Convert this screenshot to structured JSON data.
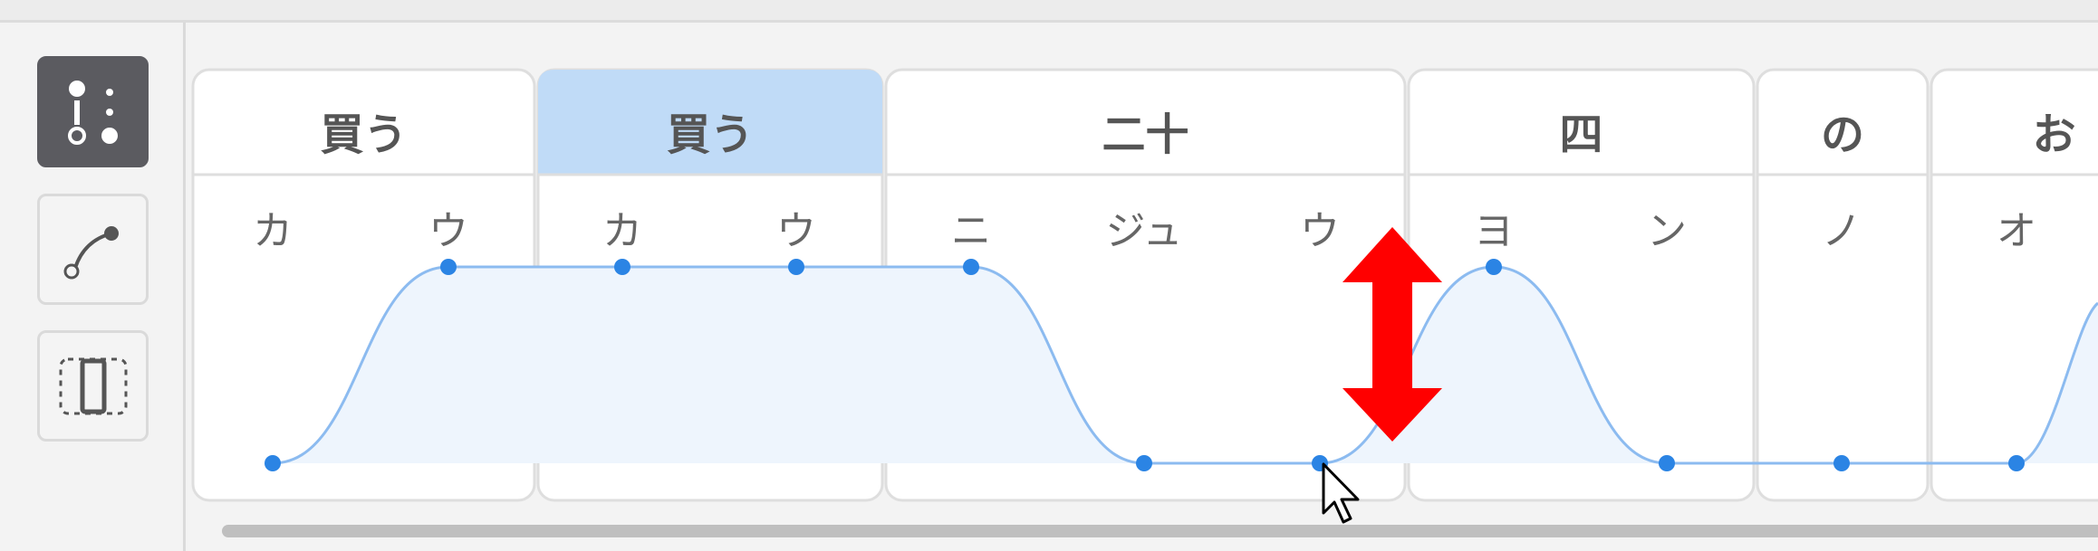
{
  "toolbar": {
    "tools": [
      {
        "name": "pitch-points-tool",
        "active": true
      },
      {
        "name": "curve-draw-tool",
        "active": false
      },
      {
        "name": "range-select-tool",
        "active": false
      }
    ]
  },
  "words": [
    {
      "text": "買う",
      "selected": false
    },
    {
      "text": "買う",
      "selected": true
    },
    {
      "text": "二十",
      "selected": false
    },
    {
      "text": "四",
      "selected": false
    },
    {
      "text": "の",
      "selected": false
    },
    {
      "text": "お",
      "selected": false
    }
  ],
  "moras": [
    "カ",
    "ウ",
    "カ",
    "ウ",
    "ニ",
    "ジュ",
    "ウ",
    "ヨ",
    "ン",
    "ノ",
    "オ"
  ],
  "accent_pattern": [
    0,
    1,
    1,
    1,
    1,
    0,
    0,
    1,
    0,
    0,
    0
  ],
  "colors": {
    "accent": "#2b84e4",
    "curve": "#8cbbf0",
    "selected_word": "#c0dbf7",
    "drag_arrow": "#ff0000"
  },
  "overlay": {
    "drag_indicator": "vertical-double-arrow",
    "cursor": "mouse-pointer"
  }
}
